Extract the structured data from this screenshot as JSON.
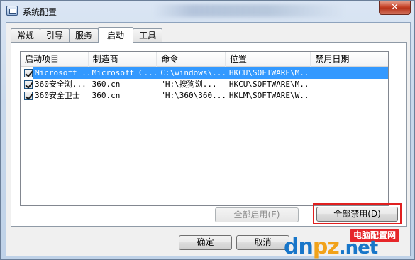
{
  "window": {
    "title": "系统配置",
    "close_symbol": "✕"
  },
  "tabs": [
    {
      "label": "常规",
      "active": false
    },
    {
      "label": "引导",
      "active": false
    },
    {
      "label": "服务",
      "active": false
    },
    {
      "label": "启动",
      "active": true
    },
    {
      "label": "工具",
      "active": false
    }
  ],
  "startup_list": {
    "columns": [
      "启动项目",
      "制造商",
      "命令",
      "位置",
      "禁用日期"
    ],
    "rows": [
      {
        "checked": true,
        "selected": true,
        "item": "Microsoft ...",
        "manufacturer": "Microsoft C...",
        "command": "C:\\windows\\...",
        "location": "HKCU\\SOFTWARE\\M...",
        "disabled_date": ""
      },
      {
        "checked": true,
        "selected": false,
        "item": "360安全浏...",
        "manufacturer": "360.cn",
        "command": "\"H:\\搜狗浏...",
        "location": "HKCU\\SOFTWARE\\M...",
        "disabled_date": ""
      },
      {
        "checked": true,
        "selected": false,
        "item": "360安全卫士",
        "manufacturer": "360.cn",
        "command": "\"H:\\360\\360...",
        "location": "HKLM\\SOFTWARE\\W...",
        "disabled_date": ""
      }
    ]
  },
  "buttons": {
    "enable_all": "全部启用(E)",
    "disable_all": "全部禁用(D)",
    "ok": "确定",
    "cancel": "取消"
  },
  "watermark": {
    "badge": "电脑配置网",
    "text_a": "dn",
    "text_b": "pz",
    "text_c": ".net"
  },
  "colors": {
    "selection": "#3399ff",
    "highlight_frame": "#e02020",
    "close_button": "#c7442a"
  }
}
